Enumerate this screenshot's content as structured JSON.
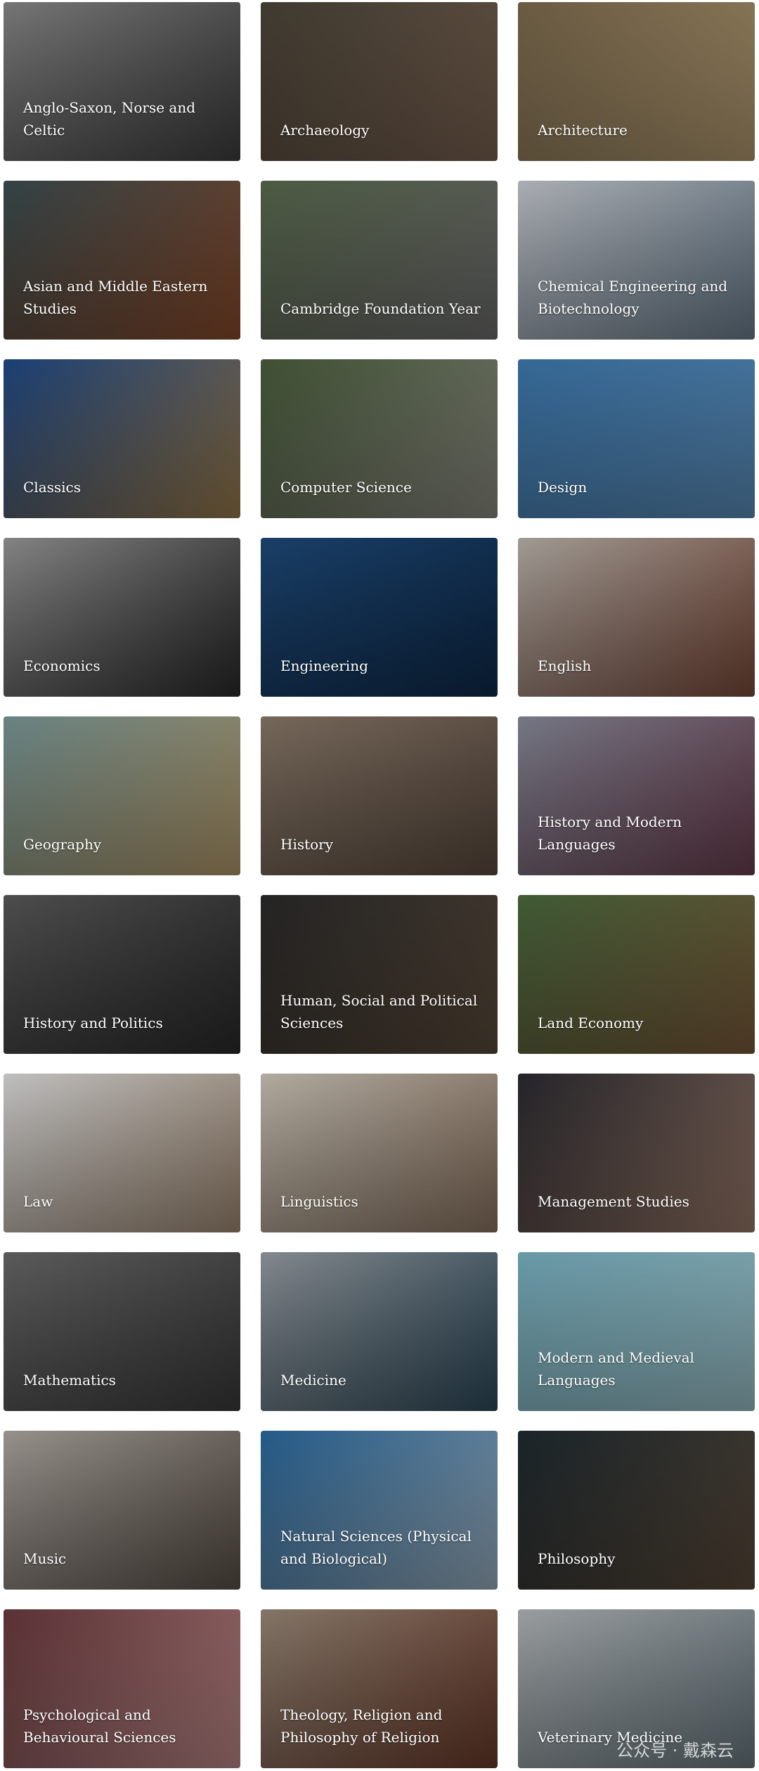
{
  "subjects": [
    {
      "label": "Anglo-Saxon, Norse and Celtic",
      "colors": [
        "#8a8a8a",
        "#3e3e3e"
      ]
    },
    {
      "label": "Archaeology",
      "colors": [
        "#4a4438",
        "#7a6250"
      ]
    },
    {
      "label": "Architecture",
      "colors": [
        "#7c6a4e",
        "#b29a70"
      ]
    },
    {
      "label": "Asian and Middle Eastern Studies",
      "colors": [
        "#3b4e52",
        "#8a4a2a"
      ]
    },
    {
      "label": "Cambridge Foundation Year",
      "colors": [
        "#5a6a4e",
        "#6c6c6c"
      ]
    },
    {
      "label": "Chemical Engineering and Biotechnology",
      "colors": [
        "#c8ccd2",
        "#6a7c8c"
      ]
    },
    {
      "label": "Classics",
      "colors": [
        "#1e4a8a",
        "#9a7a4a"
      ]
    },
    {
      "label": "Computer Science",
      "colors": [
        "#4a5e3c",
        "#8a8a80"
      ]
    },
    {
      "label": "Design",
      "colors": [
        "#3e7ab0",
        "#5a8cb8"
      ]
    },
    {
      "label": "Economics",
      "colors": [
        "#9a9a9a",
        "#2a2a2a"
      ]
    },
    {
      "label": "Engineering",
      "colors": [
        "#1e4a7a",
        "#0e2a4a"
      ]
    },
    {
      "label": "English",
      "colors": [
        "#bcb6ae",
        "#7a4a3a"
      ]
    },
    {
      "label": "Geography",
      "colors": [
        "#7a9a9a",
        "#b49a6a"
      ]
    },
    {
      "label": "History",
      "colors": [
        "#8a7a6a",
        "#5a4a3e"
      ]
    },
    {
      "label": "History and Modern Languages",
      "colors": [
        "#8a8c9c",
        "#6a3e4e"
      ]
    },
    {
      "label": "History and Politics",
      "colors": [
        "#5a5a5a",
        "#2a2a2a"
      ]
    },
    {
      "label": "Human, Social and Political Sciences",
      "colors": [
        "#2a2a2a",
        "#5a4a3a"
      ]
    },
    {
      "label": "Land Economy",
      "colors": [
        "#4a6a3e",
        "#7a5a3a"
      ]
    },
    {
      "label": "Law",
      "colors": [
        "#e0e0e0",
        "#a08a74"
      ]
    },
    {
      "label": "Linguistics",
      "colors": [
        "#d0c8bc",
        "#8a7460"
      ]
    },
    {
      "label": "Management Studies",
      "colors": [
        "#2a2a30",
        "#9a7a6a"
      ]
    },
    {
      "label": "Mathematics",
      "colors": [
        "#6a6a6a",
        "#3a3a3a"
      ]
    },
    {
      "label": "Medicine",
      "colors": [
        "#9aa0a6",
        "#2e4a5a"
      ]
    },
    {
      "label": "Modern and Medieval Languages",
      "colors": [
        "#7ab4c4",
        "#9ac0c8"
      ]
    },
    {
      "label": "Music",
      "colors": [
        "#b0aaa4",
        "#5a5048"
      ]
    },
    {
      "label": "Natural Sciences (Physical and Biological)",
      "colors": [
        "#2a6aa0",
        "#9ab0c0"
      ]
    },
    {
      "label": "Philosophy",
      "colors": [
        "#1e2a30",
        "#5a4a3a"
      ]
    },
    {
      "label": "Psychological and Behavioural Sciences",
      "colors": [
        "#6a3a3e",
        "#c08a8a"
      ]
    },
    {
      "label": "Theology, Religion and Philosophy of Religion",
      "colors": [
        "#9a8a7a",
        "#6a3a2a"
      ]
    },
    {
      "label": "Veterinary Medicine",
      "colors": [
        "#b4b8bc",
        "#6a7a80"
      ]
    }
  ],
  "watermark": "公众号 · 戴森云"
}
